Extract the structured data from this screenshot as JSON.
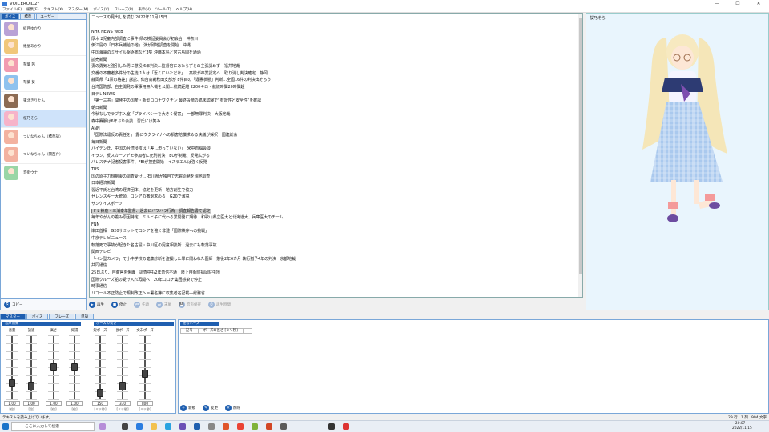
{
  "window": {
    "title": "VOICEROID2*",
    "min": "—",
    "max": "☐",
    "close": "✕"
  },
  "menu": [
    "ファイル(F)",
    "編集(E)",
    "テキスト(X)",
    "マスター(M)",
    "ボイス(V)",
    "フレーズ(P)",
    "表示(V)",
    "ツール(T)",
    "ヘルプ(H)"
  ],
  "voice_panel": {
    "tabs": [
      "ボイス",
      "標準",
      "ユーザー"
    ],
    "items": [
      "琴葉 茜",
      "琴葉 葵",
      "紲星あかり",
      "東北きりたん",
      "ついなちゃん",
      "結月ゆかり",
      "鳴花ヒメ",
      "水奈瀬コウ",
      "桜乃そら",
      "音街ウナ"
    ],
    "voices": [
      {
        "name": "結月ゆかり",
        "color": "#b9a2d6"
      },
      {
        "name": "紲星あかり",
        "color": "#f1c77a"
      },
      {
        "name": "琴葉 茜",
        "color": "#f29bb0"
      },
      {
        "name": "琴葉 葵",
        "color": "#8fc2ee"
      },
      {
        "name": "東北きりたん",
        "color": "#8c6b53"
      },
      {
        "name": "桜乃そら",
        "color": "#f6b3c9"
      },
      {
        "name": "ついなちゃん（標準語）",
        "color": "#f3b2a0"
      },
      {
        "name": "ついなちゃん（関西弁）",
        "color": "#f3b2a0"
      },
      {
        "name": "音街ウナ",
        "color": "#9ad6a6"
      }
    ],
    "copy_label": "コピー"
  },
  "editor_lines": [
    "ニュースの見出しを読む 2022年11月15日",
    "",
    "NHK NEWS WEB",
    "厚木 2児童内部調査に事件 県の検証委員会が初会合　神奈川",
    "伊江島の「日本兵補給の地」 演が残地調査を開始　沖縄",
    "中国海軍のミサイル駆逐艦など3隻 沖縄本島と宮古島間を通過",
    "読売新聞",
    "妻の勇気と強引した男に懲役 6年判決…監督官にあたらずとの主張認めず　福井地裁",
    "交番の不審者多件分の生徒 1人は「近くにいただけ」…高校が卒業認定へ…取り消し判決確定　静岡",
    "静岡県「1票の格差」訴訟、仙台高裁秋田支部が 8件目の「違憲状態」判断…全国16件の判決出そろう",
    "台湾国防部、自主開発の軍事用無人機を公開…航続距離 2200キロ・航続時間20時間超",
    "日テレNEWS",
    "「第一三共」開発中の国産・新型コロナワクチン 最終段階の臨床試験で“有効性と安全性”を確認",
    "朝日新聞",
    "今秋なしでラブホ入室「プライバシーを大きく侵害」　一部無罪判決　大阪地裁",
    "森中賽脈は6年ぶり会談　習氏には笑み",
    "ANN",
    "「国際法違反の責任を」 露にウクライナへの損害賠償求める決議が採択　国連総会",
    "毎日新聞",
    "バイデン氏、中国の台湾侵攻は「差し迫っていない」　米中首脳会談",
    "イラン、反スカーフデモ参加者に死刑判決　EUが制裁、反発広がる",
    "パレスチナ記者殺害事件、FBIが捜査開始　イスラエルは強く反発",
    "TBS",
    "国の原子力規制委の調査受け… 石川県が独自で志賀原発を現地調査",
    "日本経済新聞",
    "習近平氏と台湾の経済団体、協定を更新　地方創生で協力",
    "ゼレンスキー大統領、ロシアの撤退求める　G20で演説",
    "サンケイスポーツ",
    "J F L 鈴鹿・三浦泰年監督、過去にパワハラ行為　調査報告書で認定",
    "毎年やがんの着み原因特定　ミルヒ子に代わる業開発に期待　和歌山県立医大と北海道大、兵庫医大のチーム",
    "FNN",
    "岸田首相　G20サミットでロシアを強く非難「国際秩序への挑戦」",
    "中京テレビニュース",
    "転落死で事故が起きた名古屋・中川区の児童相談所　過去にも転落事故",
    "関西テレビ",
    "「ペン型カメラ」で小中学校の健康診断を盗撮した罪に問われた医師　懲役2年6カ月 執行猶予4年の判決　京都地裁",
    "共同通信",
    "25日ぶり、自衛官を免職　調査中も2年音信不通　陸上自衛隊福岡駐屯地",
    "国際クルーズ船の受け入れ再開へ　20年コロナ集団感染で停止",
    "時事通信",
    "リコール不正防止で規制改正へ＝署名簿に収集者名記載―総務省",
    "米、ロシア資金源に制裁＝軍需一族や軍事企業",
    "東洋経済オンライン",
    "カナダ政府、中国企業に「出資引き揚げ」を命令　国家安全保障を理由に リチウム開発に介入"
  ],
  "playbar": [
    "再生",
    "停止",
    "先頭",
    "末尾",
    "音声保存",
    "再生時間"
  ],
  "character_name": "桜乃そら",
  "bottom_tabs": [
    "マスター",
    "ボイス",
    "フレーズ",
    "単語"
  ],
  "slider_groups": {
    "master": "音声効果",
    "pose": "ポーズの長さ"
  },
  "sliders": [
    {
      "label": "音量",
      "value": "1.00",
      "unit": "[倍]",
      "level": 0.25
    },
    {
      "label": "話速",
      "value": "1.00",
      "unit": "[倍]",
      "level": 0.2
    },
    {
      "label": "高さ",
      "value": "1.00",
      "unit": "[倍]",
      "level": 0.5
    },
    {
      "label": "抑揚",
      "value": "1.00",
      "unit": "[倍]",
      "level": 0.5
    },
    {
      "label": "短ポーズ",
      "value": "150",
      "unit": "[ミリ秒]",
      "level": 0.1
    },
    {
      "label": "長ポーズ",
      "value": "370",
      "unit": "[ミリ秒]",
      "level": 0.2
    },
    {
      "label": "文末ポーズ",
      "value": "800",
      "unit": "[ミリ秒]",
      "level": 0.4
    }
  ],
  "pose_panel": {
    "header": "記号ポーズ",
    "columns": [
      "記号",
      "ポーズの長さ [ミリ秒]"
    ],
    "buttons": [
      "新規",
      "変更",
      "削除"
    ]
  },
  "status": {
    "left": "テキストを読み上げています。",
    "pos": "29 行 , 1 列",
    "chars": "994 文字"
  },
  "taskbar": {
    "search_placeholder": "ここに入力して検索",
    "time": "20:07",
    "date": "2022/11/15"
  }
}
